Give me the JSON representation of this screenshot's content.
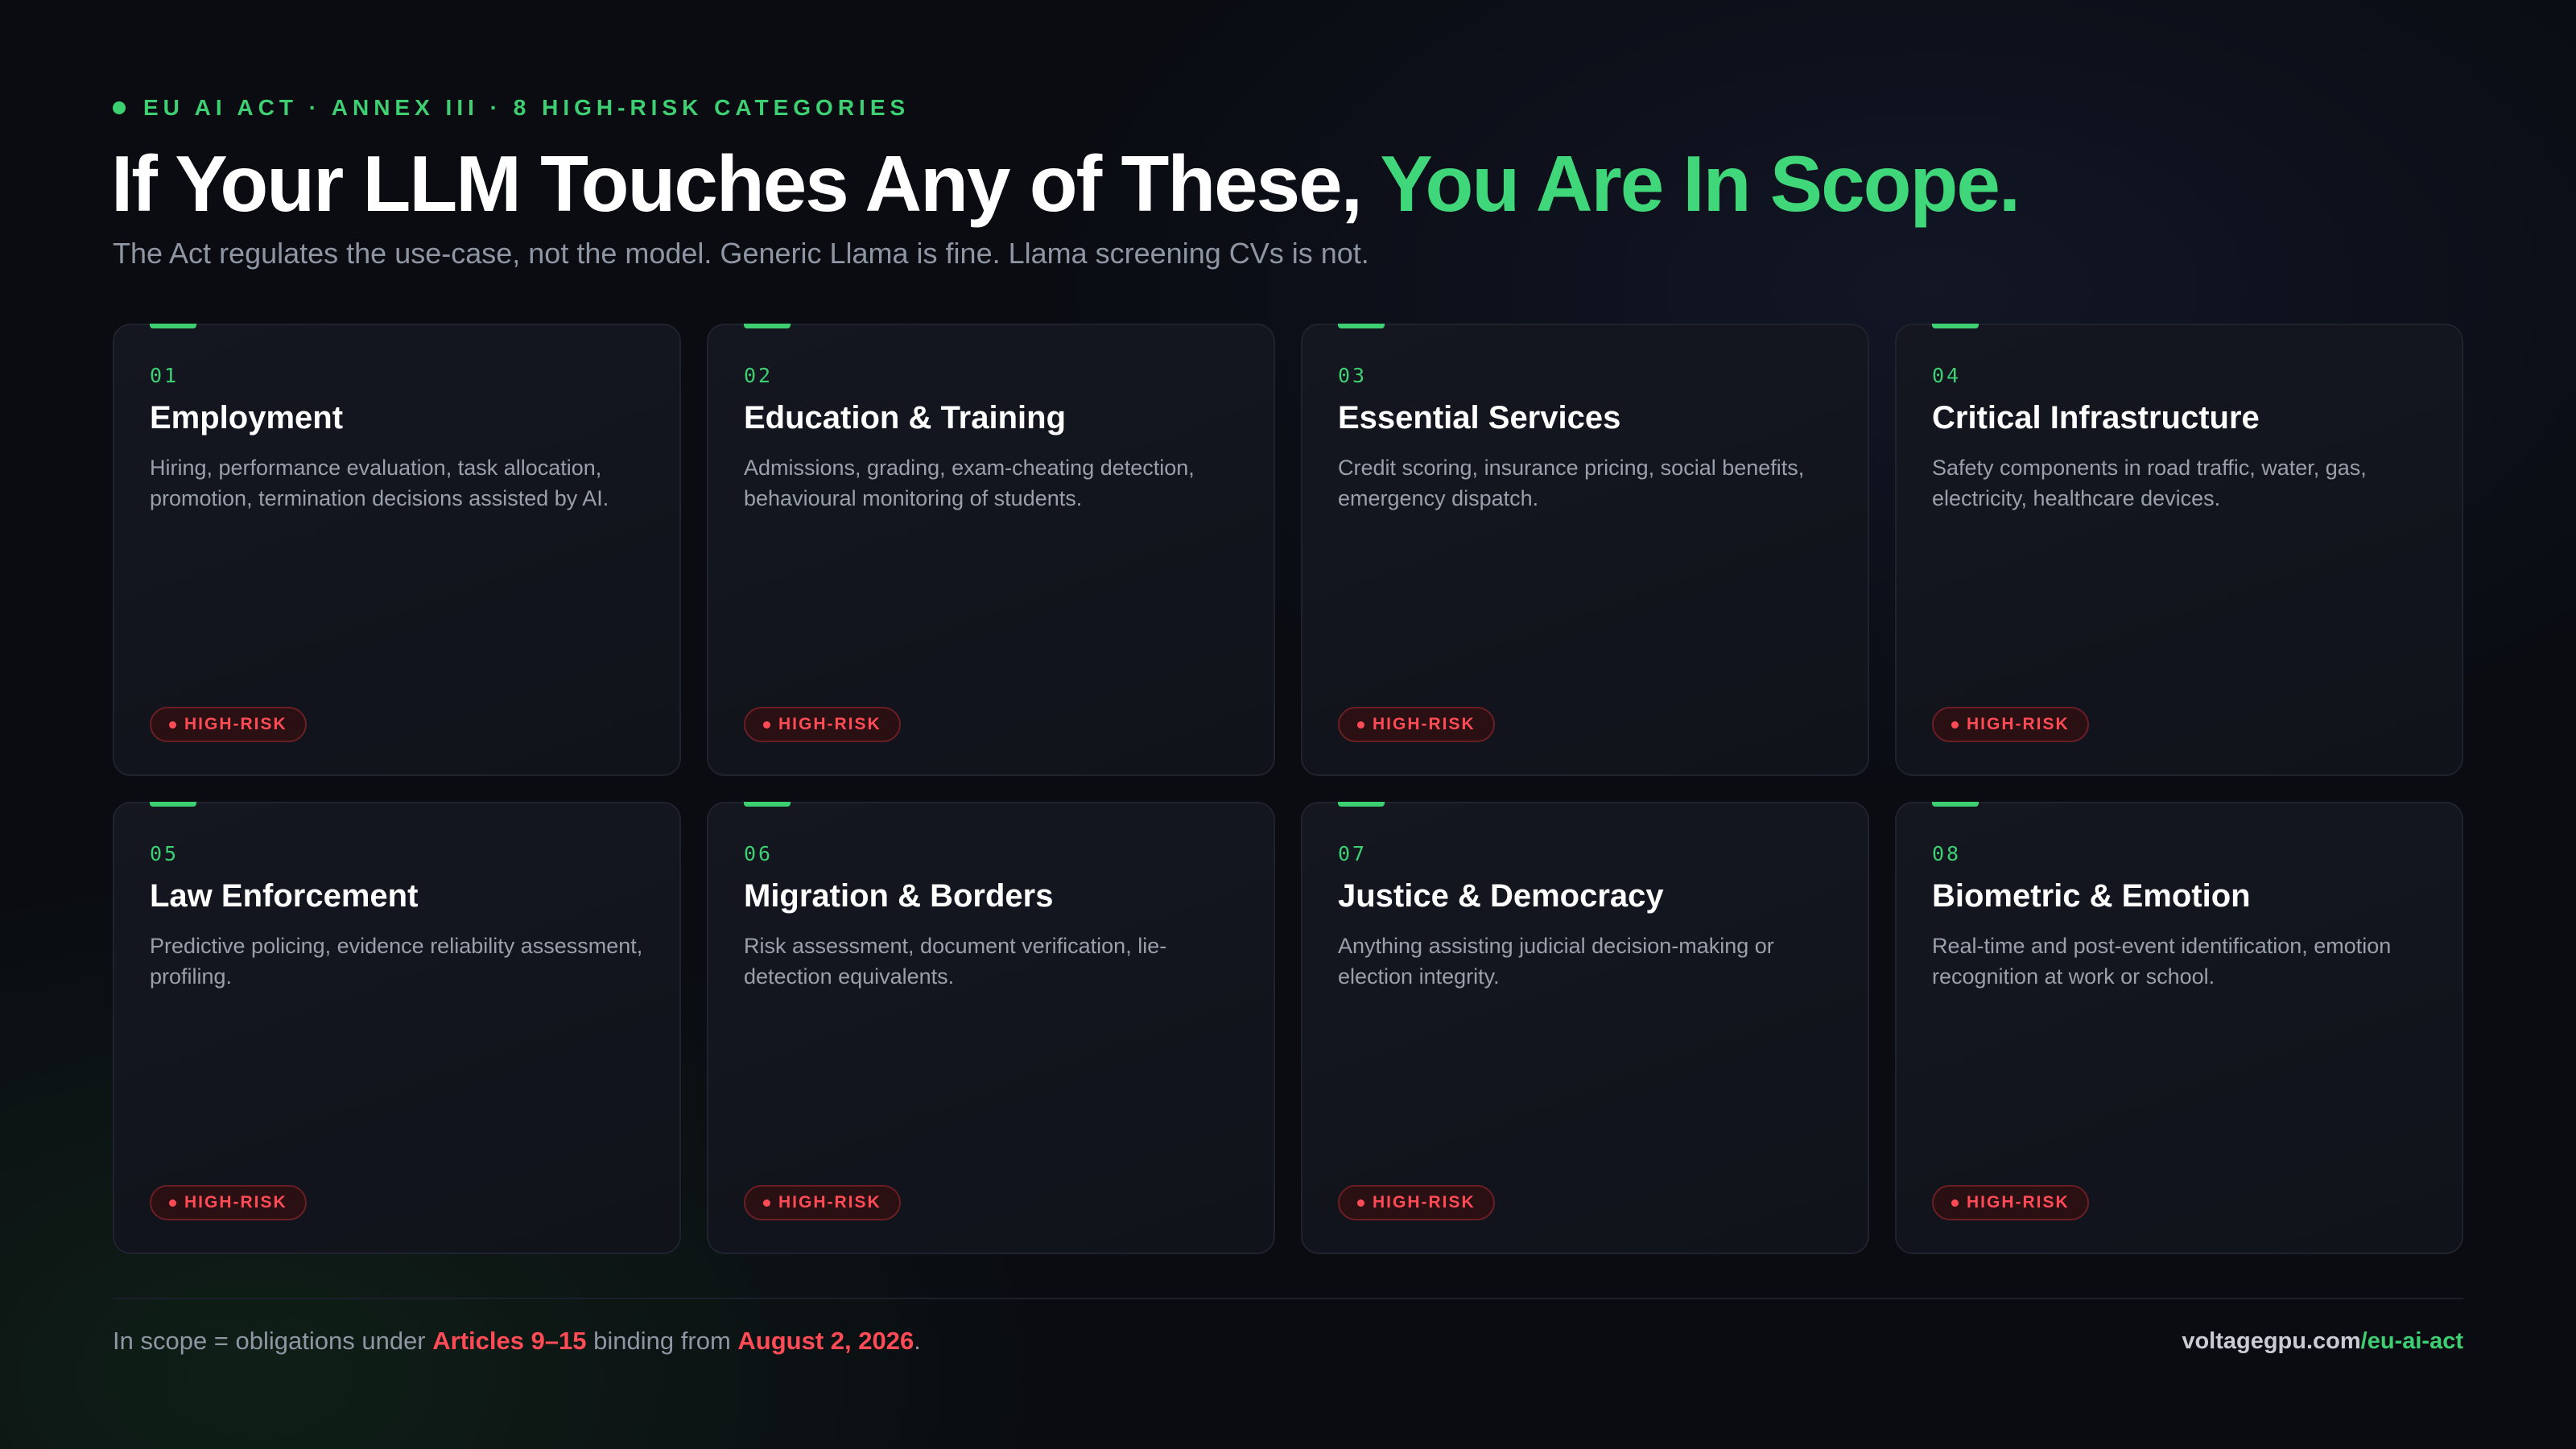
{
  "header": {
    "eyebrow": "EU AI ACT · ANNEX III · 8 HIGH-RISK CATEGORIES",
    "title_main": "If Your LLM Touches Any of These, ",
    "title_accent": "You Are In Scope.",
    "subtitle": "The Act regulates the use-case, not the model. Generic Llama is fine. Llama screening CVs is not."
  },
  "badge_label": "HIGH-RISK",
  "colors": {
    "accent": "#3ecf72",
    "danger": "#ff4b55",
    "background": "#0a0c12"
  },
  "cards": [
    {
      "num": "01",
      "title": "Employment",
      "desc": "Hiring, performance evaluation, task allocation, promotion, termination decisions assisted by AI."
    },
    {
      "num": "02",
      "title": "Education & Training",
      "desc": "Admissions, grading, exam-cheating detection, behavioural monitoring of students."
    },
    {
      "num": "03",
      "title": "Essential Services",
      "desc": "Credit scoring, insurance pricing, social benefits, emergency dispatch."
    },
    {
      "num": "04",
      "title": "Critical Infrastructure",
      "desc": "Safety components in road traffic, water, gas, electricity, healthcare devices."
    },
    {
      "num": "05",
      "title": "Law Enforcement",
      "desc": "Predictive policing, evidence reliability assessment, profiling."
    },
    {
      "num": "06",
      "title": "Migration & Borders",
      "desc": "Risk assessment, document verification, lie-detection equivalents."
    },
    {
      "num": "07",
      "title": "Justice & Democracy",
      "desc": "Anything assisting judicial decision-making or election integrity."
    },
    {
      "num": "08",
      "title": "Biometric & Emotion",
      "desc": "Real-time and post-event identification, emotion recognition at work or school."
    }
  ],
  "footer": {
    "text_1": "In scope = obligations under ",
    "articles": "Articles 9–15",
    "text_2": " binding from ",
    "date": "August 2, 2026",
    "text_3": ".",
    "link_host": "voltagegpu.com",
    "link_path": "/eu-ai-act"
  }
}
